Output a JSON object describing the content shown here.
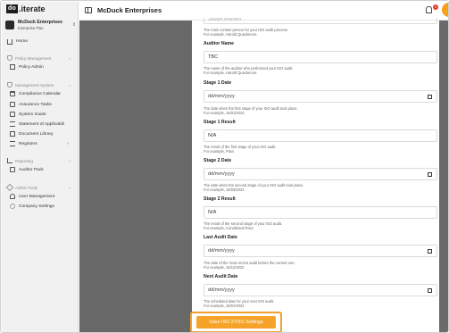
{
  "app": {
    "logo_box": "do",
    "logo_rest": "iterate",
    "logo_dot": "."
  },
  "org": {
    "name": "McDuck Enterprises",
    "plan": "Enterprise Plan"
  },
  "sidebar": {
    "home": "Home",
    "sections": {
      "policy": "Policy Management",
      "management": "Management System",
      "reporting": "Reporting",
      "admin": "Admin Tools"
    },
    "items": {
      "policy_admin": "Policy Admin",
      "compliance_calendar": "Compliance Calendar",
      "assurance_tasks": "Assurance Tasks",
      "system_guide": "System Guide",
      "statement": "Statement of Applicabili",
      "document_library": "Document Library",
      "registers": "Registers",
      "auditor_pack": "Auditor Pack",
      "user_management": "User Management",
      "company_settings": "Company Settings"
    }
  },
  "topbar": {
    "title": "McDuck Enterprises",
    "notification_count": "1"
  },
  "form": {
    "top_cut_value": "Joseph Bracken",
    "top_help_1": "The main contact person for your ISO audit process.",
    "top_help_2": "For example, Harold Quackmore.",
    "auditor_name": {
      "label": "Auditor Name",
      "value": "TBC",
      "help_1": "The name of the auditor who performed your ISO audit.",
      "help_2": "For example, Harold Quackmore."
    },
    "stage1_date": {
      "label": "Stage 1 Date",
      "placeholder": "dd/mm/yyyy",
      "help_1": "The date when the first stage of your ISO audit took place.",
      "help_2": "For example, 15/01/2023"
    },
    "stage1_result": {
      "label": "Stage 1 Result",
      "value": "N/A",
      "help_1": "The result of the first stage of your ISO audit.",
      "help_2": "For example, Pass"
    },
    "stage2_date": {
      "label": "Stage 2 Date",
      "placeholder": "dd/mm/yyyy",
      "help_1": "The date when the second stage of your ISO audit took place.",
      "help_2": "For example, 15/03/2023"
    },
    "stage2_result": {
      "label": "Stage 2 Result",
      "value": "N/A",
      "help_1": "The result of the second stage of your ISO audit.",
      "help_2": "For example, Conditional Pass"
    },
    "last_audit": {
      "label": "Last Audit Date",
      "placeholder": "dd/mm/yyyy",
      "help_1": "The date of the most recent audit before the current one.",
      "help_2": "For example, 15/12/2022"
    },
    "next_audit": {
      "label": "Next Audit Date",
      "placeholder": "dd/mm/yyyy",
      "help_1": "The scheduled date for your next ISO audit.",
      "help_2": "For example, 15/01/2024"
    },
    "save_label": "Save ISO 27001 Settings"
  },
  "colors": {
    "accent": "#f6a329",
    "overlay": "#686868",
    "badge": "#e23b2e"
  }
}
